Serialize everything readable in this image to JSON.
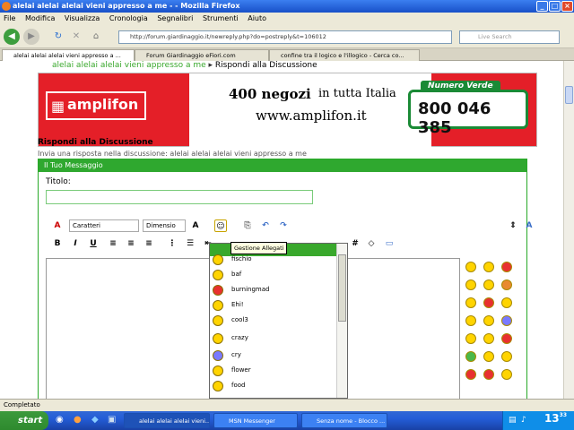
{
  "window": {
    "title": "alelai alelai alelai vieni appresso a me - - Mozilla Firefox"
  },
  "menu": [
    "File",
    "Modifica",
    "Visualizza",
    "Cronologia",
    "Segnalibri",
    "Strumenti",
    "Aiuto"
  ],
  "nav": {
    "url": "http://forum.giardinaggio.it/newreply.php?do=postreply&t=106012",
    "search_placeholder": "Live Search"
  },
  "tabs": [
    {
      "label": "alelai alelai alelai vieni appresso a ..."
    },
    {
      "label": "Forum Giardinaggio eFiori.com"
    },
    {
      "label": "confine tra il logico e l'illogico - Cerca co..."
    }
  ],
  "page": {
    "breadcrumb_1": "alelai alelai alelai vieni appresso a me",
    "breadcrumb_2": "Rispondi alla Discussione",
    "ad": {
      "brand": "amplifon",
      "line1": "400 negozi",
      "line1b": "in tutta Italia",
      "line2": "www.amplifon.it",
      "num_label": "Numero Verde",
      "number": "800 046 385"
    },
    "reply_title": "Rispondi alla Discussione",
    "reply_sub": "Invia una risposta nella discussione: alelai alelai alelai vieni appresso a me",
    "box_header": "Il Tuo Messaggio",
    "title_label": "Titolo:",
    "font_select": "Caratteri",
    "size_select": "Dimensio",
    "tooltip": "Gestione Allegati",
    "dropdown_items": [
      {
        "label": "",
        "color": "#ffd400"
      },
      {
        "label": "fischio",
        "color": "#ffd400"
      },
      {
        "label": "baf",
        "color": "#ffd400"
      },
      {
        "label": "burningmad",
        "color": "#e83030"
      },
      {
        "label": "Ehi!",
        "color": "#ffd400"
      },
      {
        "label": "cool3",
        "color": "#ffd400"
      },
      {
        "label": "crazy",
        "color": "#ffd400"
      },
      {
        "label": "cry",
        "color": "#7a7aff"
      },
      {
        "label": "flower",
        "color": "#ffd400"
      },
      {
        "label": "food",
        "color": "#ffd400"
      }
    ]
  },
  "status": "Completato",
  "taskbar": {
    "start": "start",
    "tasks": [
      "alelai alelai alelai vieni...",
      "MSN Messenger",
      "Senza nome - Blocco ..."
    ],
    "clock": "13",
    "clock_min": "33"
  }
}
